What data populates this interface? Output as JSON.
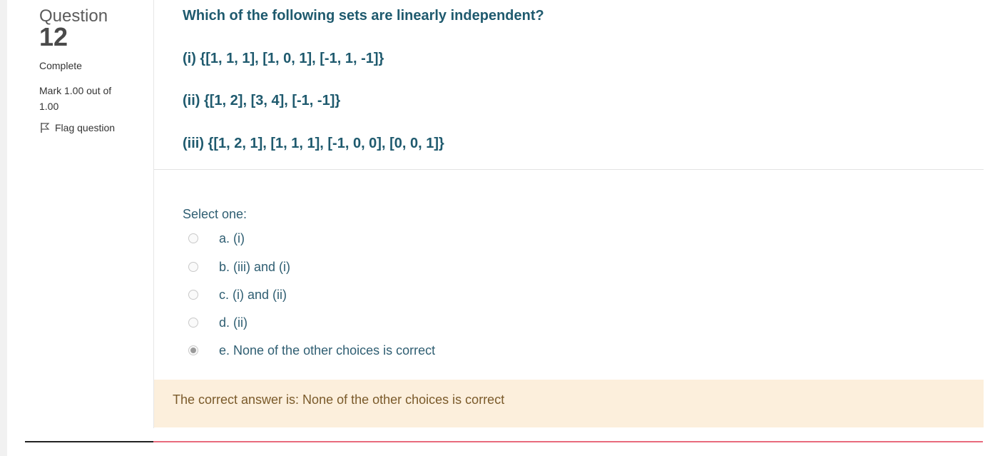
{
  "question_info": {
    "label": "Question",
    "number": "12",
    "state": "Complete",
    "grade": "Mark 1.00 out of 1.00",
    "flag_label": "Flag question"
  },
  "question": {
    "prompt": "Which of the following sets are linearly independent?",
    "items": [
      "(i) {[1, 1, 1], [1, 0, 1], [-1, 1, -1]}",
      "(ii) {[1, 2], [3, 4], [-1, -1]}",
      "(iii) {[1, 2, 1], [1, 1, 1], [-1, 0, 0], [0, 0, 1]}"
    ]
  },
  "answer": {
    "prompt": "Select one:",
    "options": [
      {
        "label": "a. (i)",
        "selected": false
      },
      {
        "label": "b. (iii) and (i)",
        "selected": false
      },
      {
        "label": "c. (i) and (ii)",
        "selected": false
      },
      {
        "label": "d. (ii)",
        "selected": false
      },
      {
        "label": "e. None of the other choices is correct",
        "selected": true
      }
    ]
  },
  "feedback": {
    "text": "The correct answer is: None of the other choices is correct"
  },
  "colors": {
    "question_text": "#1f5a6e",
    "feedback_bg": "#fcefdc",
    "feedback_text": "#7a5a2a",
    "bottom_rule_accent": "#e86b7d"
  },
  "icons": {
    "flag": "flag-icon",
    "radio": "radio-icon"
  }
}
